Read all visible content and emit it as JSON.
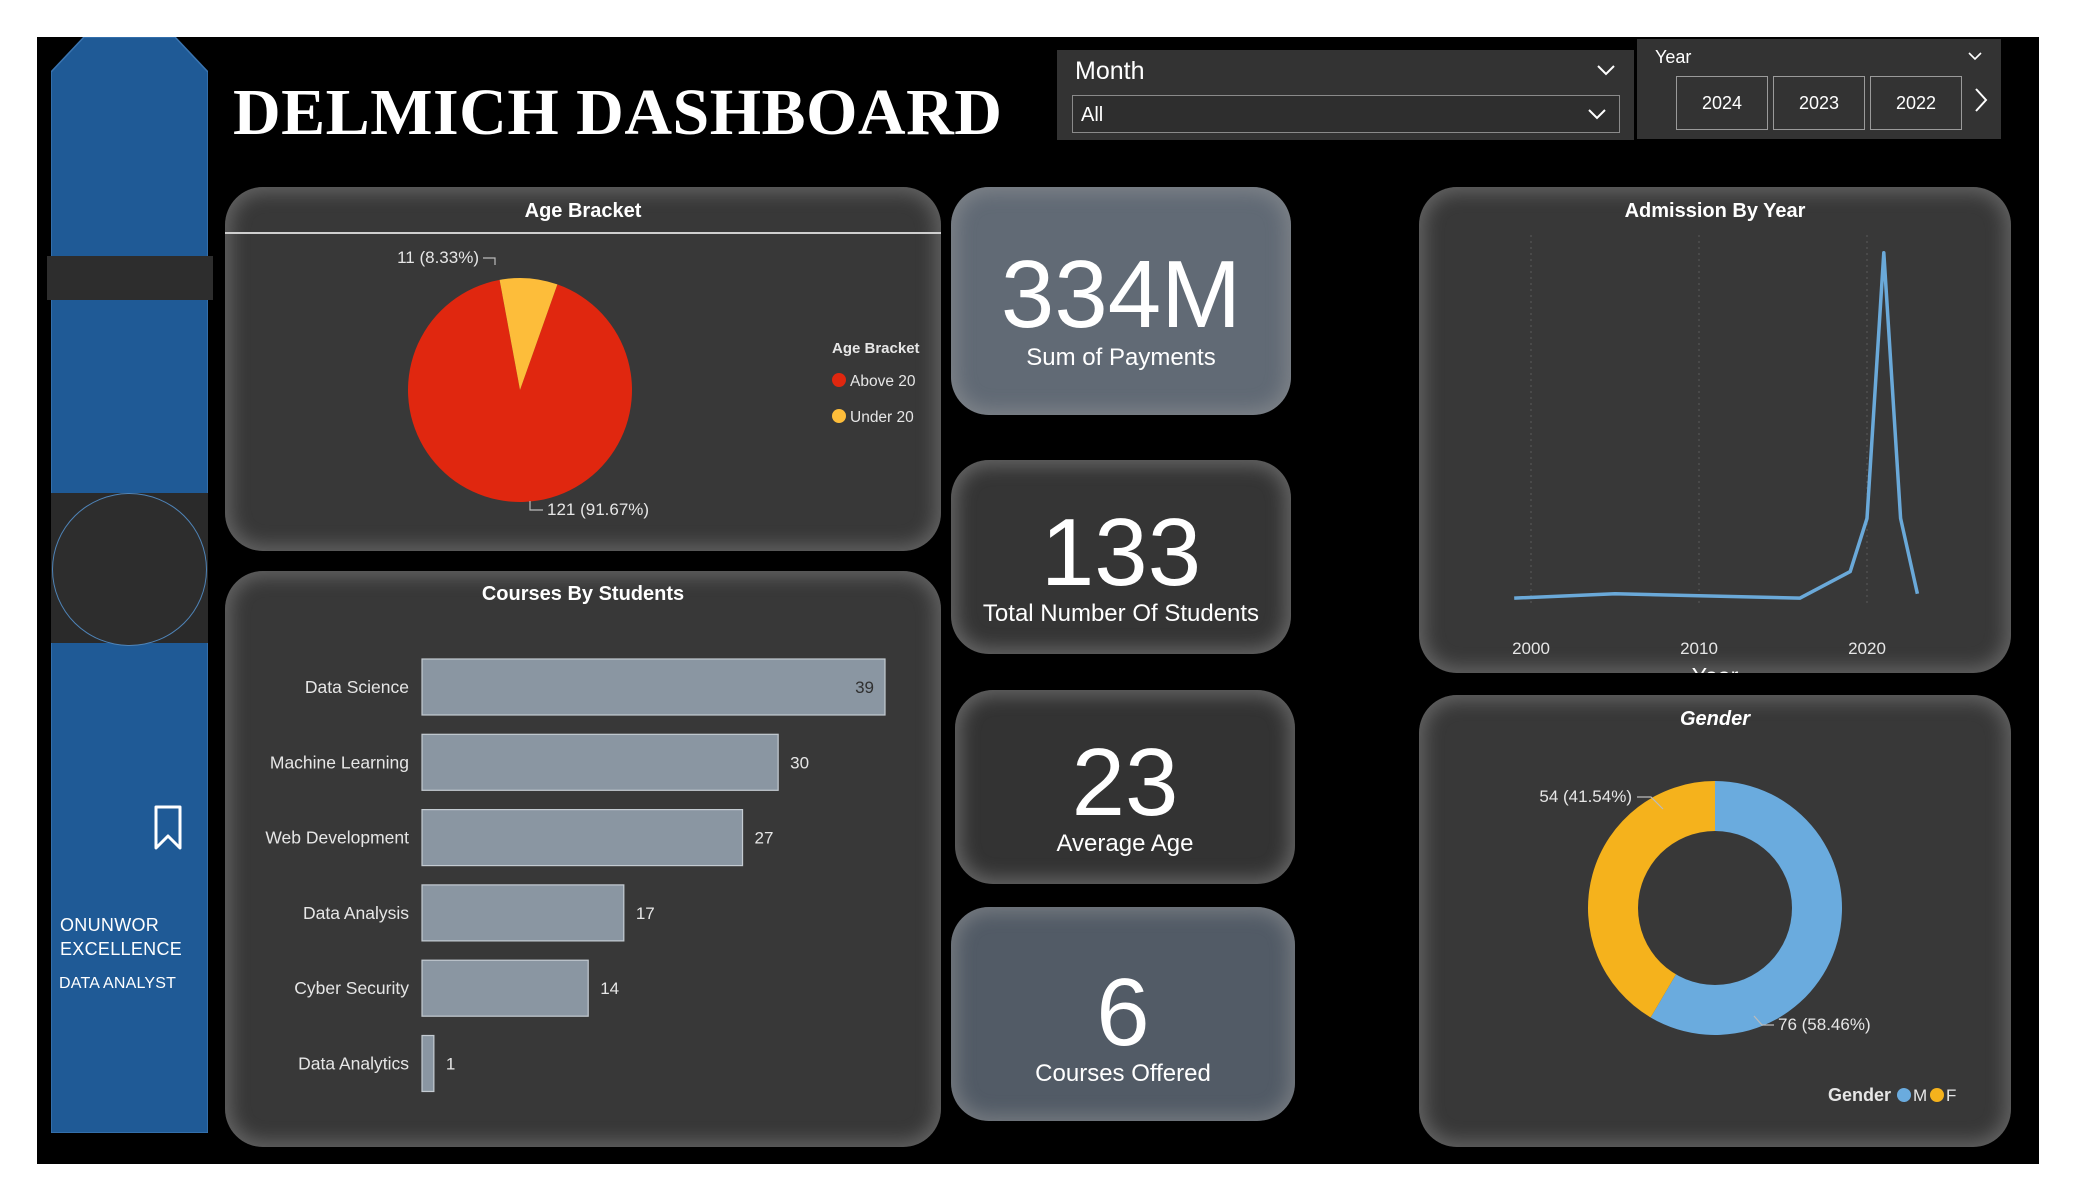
{
  "header": {
    "title": "DELMICH DASHBOARD"
  },
  "sidebar": {
    "owner_name": "ONUNWOR EXCELLENCE",
    "owner_role": "DATA ANALYST",
    "icons": {
      "bookmark": "bookmark-icon"
    },
    "color": "#1f5a96"
  },
  "filters": {
    "month": {
      "label": "Month",
      "value": "All"
    },
    "year": {
      "label": "Year",
      "options": [
        "2024",
        "2023",
        "2022"
      ]
    }
  },
  "kpis": {
    "payments": {
      "value": "334M",
      "label": "Sum of Payments"
    },
    "students": {
      "value": "133",
      "label": "Total Number Of Students"
    },
    "age": {
      "value": "23",
      "label": "Average Age"
    },
    "courses": {
      "value": "6",
      "label": "Courses Offered"
    }
  },
  "colors": {
    "above20": "#e0270f",
    "under20": "#fdbd3a",
    "bar": "#8a96a2",
    "line": "#6aa9d9",
    "male": "#6aabde",
    "female": "#f5b21c"
  },
  "chart_data": [
    {
      "type": "pie",
      "title": "Age Bracket",
      "legend_title": "Age Bracket",
      "legend_position": "right",
      "slices": [
        {
          "label": "Above 20",
          "value": 121,
          "data_label": "121 (91.67%)"
        },
        {
          "label": "Under 20",
          "value": 11,
          "data_label": "11 (8.33%)"
        }
      ]
    },
    {
      "type": "bar",
      "orientation": "horizontal",
      "title": "Courses By Students",
      "categories": [
        "Data Science",
        "Machine Learning",
        "Web Development",
        "Data Analysis",
        "Cyber Security",
        "Data Analytics"
      ],
      "values": [
        39,
        30,
        27,
        17,
        14,
        1
      ],
      "xlim": [
        0,
        39
      ]
    },
    {
      "type": "line",
      "title": "Admission By Year",
      "xlabel": "Year",
      "ylabel": "",
      "x": [
        1999,
        2005,
        2016,
        2019,
        2020,
        2021,
        2022,
        2023
      ],
      "y": [
        2,
        3,
        2,
        8,
        20,
        80,
        20,
        3
      ],
      "xticks": [
        2000,
        2010,
        2020
      ],
      "xlim": [
        1998,
        2024
      ],
      "ylim": [
        0,
        84
      ],
      "grid": "vertical dotted"
    },
    {
      "type": "pie",
      "variant": "donut",
      "title": "Gender",
      "legend_title": "Gender",
      "legend_position": "bottom-right",
      "slices": [
        {
          "label": "M",
          "value": 76,
          "data_label": "76 (58.46%)"
        },
        {
          "label": "F",
          "value": 54,
          "data_label": "54 (41.54%)"
        }
      ]
    }
  ]
}
